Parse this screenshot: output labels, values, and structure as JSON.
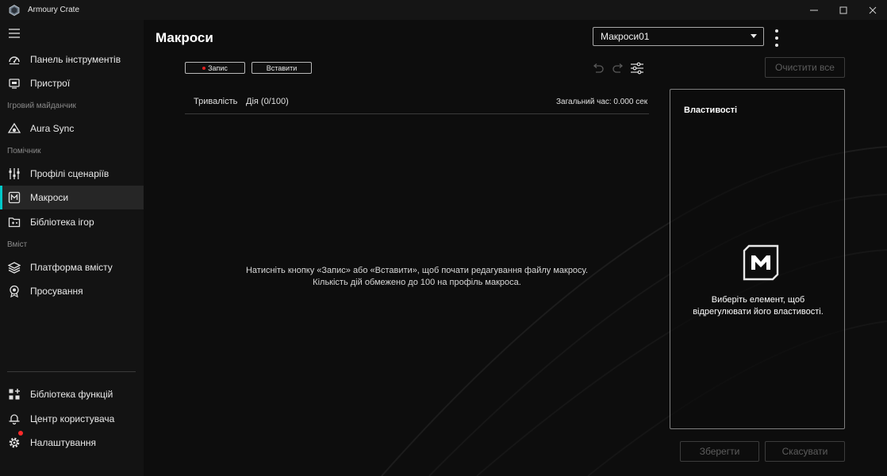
{
  "app": {
    "title": "Armoury Crate"
  },
  "window_controls": [
    "minimize-icon",
    "maximize-icon",
    "close-icon"
  ],
  "sidebar": {
    "sections": {
      "game_zone": "Ігровий майданчик",
      "assistant": "Помічник",
      "content": "Вміст"
    },
    "items": [
      {
        "label": "Панель інструментів",
        "icon": "dashboard-icon"
      },
      {
        "label": "Пристрої",
        "icon": "device-icon"
      },
      {
        "label": "Aura Sync",
        "icon": "aura-icon"
      },
      {
        "label": "Профілі сценаріїв",
        "icon": "scenario-icon"
      },
      {
        "label": "Макроси",
        "icon": "macro-icon",
        "active": true
      },
      {
        "label": "Бібліотека ігор",
        "icon": "game-library-icon"
      },
      {
        "label": "Платформа вмісту",
        "icon": "layers-icon"
      },
      {
        "label": "Просування",
        "icon": "promotion-icon"
      }
    ],
    "bottom_items": [
      {
        "label": "Бібліотека функцій",
        "icon": "feature-library-icon"
      },
      {
        "label": "Центр користувача",
        "icon": "user-center-icon"
      },
      {
        "label": "Налаштування",
        "icon": "settings-icon",
        "has_notification": true
      }
    ]
  },
  "main": {
    "title": "Макроси",
    "profile_select": {
      "value": "Макроси01"
    },
    "buttons": {
      "record": "Запис",
      "insert": "Вставити",
      "clear_all": "Очистити все",
      "save": "Зберегти",
      "cancel": "Скасувати"
    },
    "list": {
      "col_duration": "Тривалість",
      "col_action": "Дія (0/100)",
      "total_time": "Загальний час: 0.000 сек"
    },
    "empty_message": {
      "line1": "Натисніть кнопку «Запис» або «Вставити», щоб почати редагування файлу макросу.",
      "line2": "Кількість дій обмежено до 100 на профіль макроса."
    },
    "properties": {
      "title": "Властивості",
      "message_line1": "Виберіть елемент, щоб",
      "message_line2": "відрегулювати його властивості."
    }
  },
  "colors": {
    "accent": "#00c8c8",
    "record_dot": "#e02020",
    "notification": "#ff2a2a",
    "background": "#0d0d0d",
    "sidebar": "#131313"
  }
}
